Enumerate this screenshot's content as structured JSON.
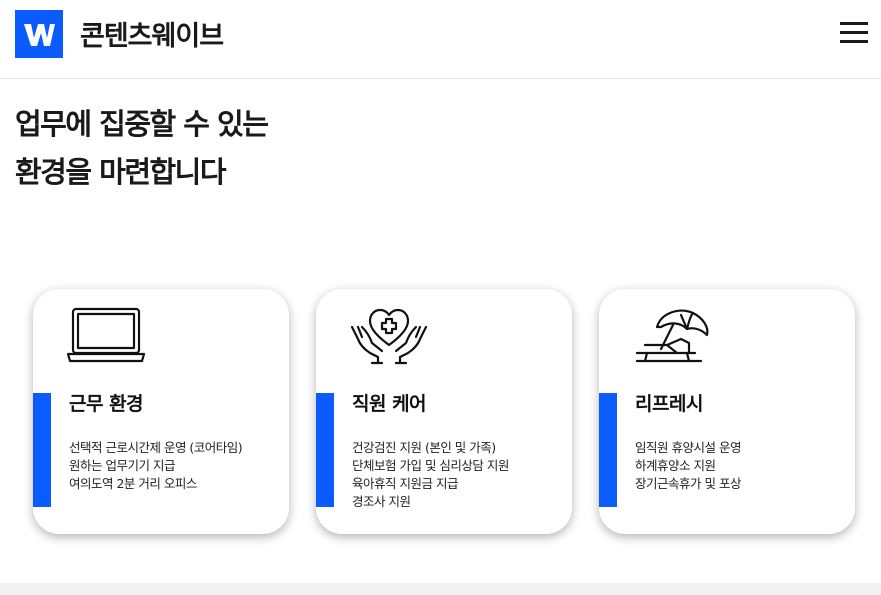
{
  "header": {
    "brand": "콘텐츠웨이브",
    "logo_icon": "wavve-logo-icon",
    "menu_icon": "hamburger-menu-icon"
  },
  "headline": {
    "line1": "업무에 집중할 수 있는",
    "line2": "환경을 마련합니다"
  },
  "accent_color": "#0a5cff",
  "cards": [
    {
      "icon": "laptop-icon",
      "title": "근무 환경",
      "items": [
        "선택적 근로시간제 운영 (코어타임)",
        "원하는 업무기기 지급",
        "여의도역 2분 거리 오피스"
      ]
    },
    {
      "icon": "caring-hands-heart-icon",
      "title": "직원 케어",
      "items": [
        "건강검진 지원 (본인 및 가족)",
        "단체보험 가입 및 심리상담 지원",
        "육아휴직 지원금 지급",
        "경조사 지원"
      ]
    },
    {
      "icon": "beach-chair-umbrella-icon",
      "title": "리프레시",
      "items": [
        "임직원 휴양시설 운영",
        "하계휴양소 지원",
        "장기근속휴가 및 포상"
      ]
    }
  ]
}
